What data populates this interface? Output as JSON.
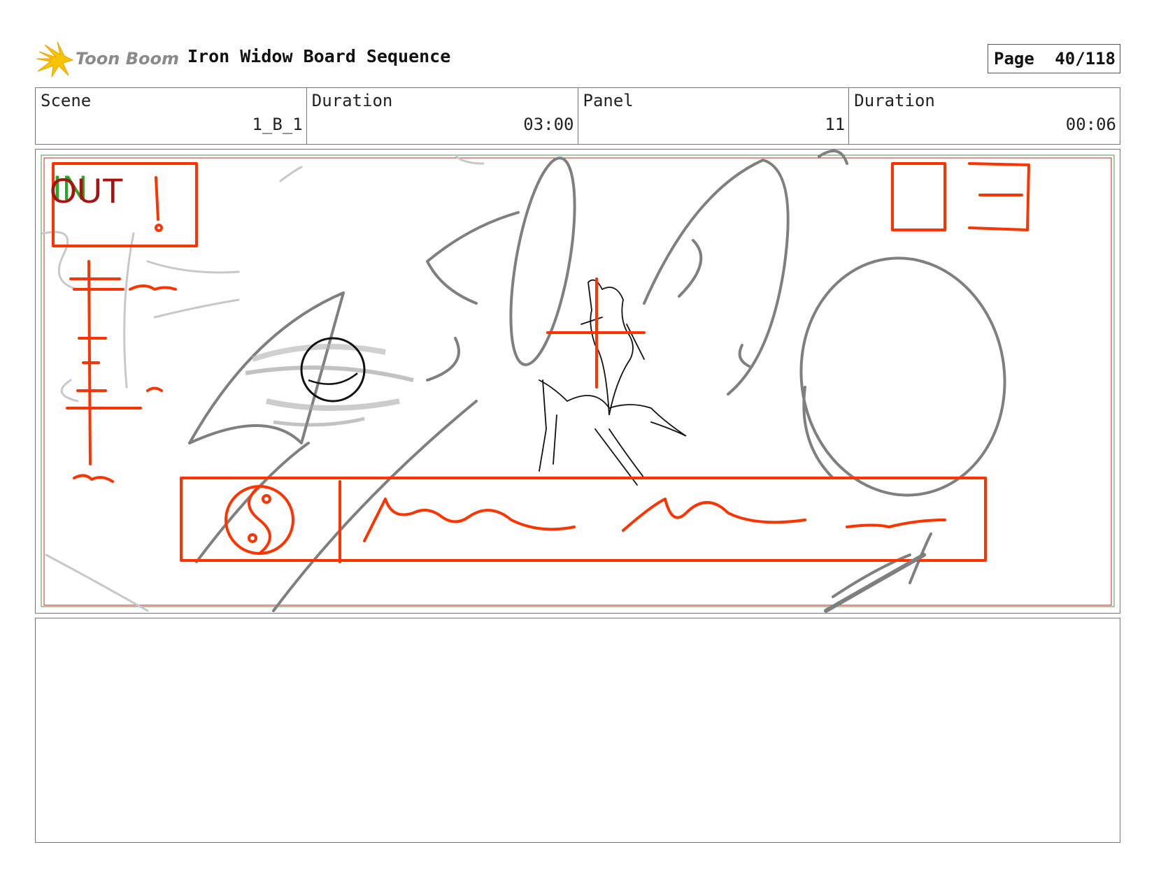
{
  "header": {
    "logo_text": "Toon Boom",
    "title": "Iron Widow Board Sequence",
    "page_label": "Page",
    "page_value": "40/118"
  },
  "info": {
    "scene_label": "Scene",
    "scene_value": "1_B_1",
    "scene_duration_label": "Duration",
    "scene_duration_value": "03:00",
    "panel_label": "Panel",
    "panel_value": "11",
    "panel_duration_label": "Duration",
    "panel_duration_value": "00:06"
  },
  "panel": {
    "in_text": "IN",
    "out_text": "OUT",
    "colors": {
      "sketch": "#808080",
      "overlay": "#ff3300",
      "figure": "#111111",
      "in": "#22aa22",
      "out": "#aa1111"
    }
  },
  "notes": {
    "text": ""
  }
}
